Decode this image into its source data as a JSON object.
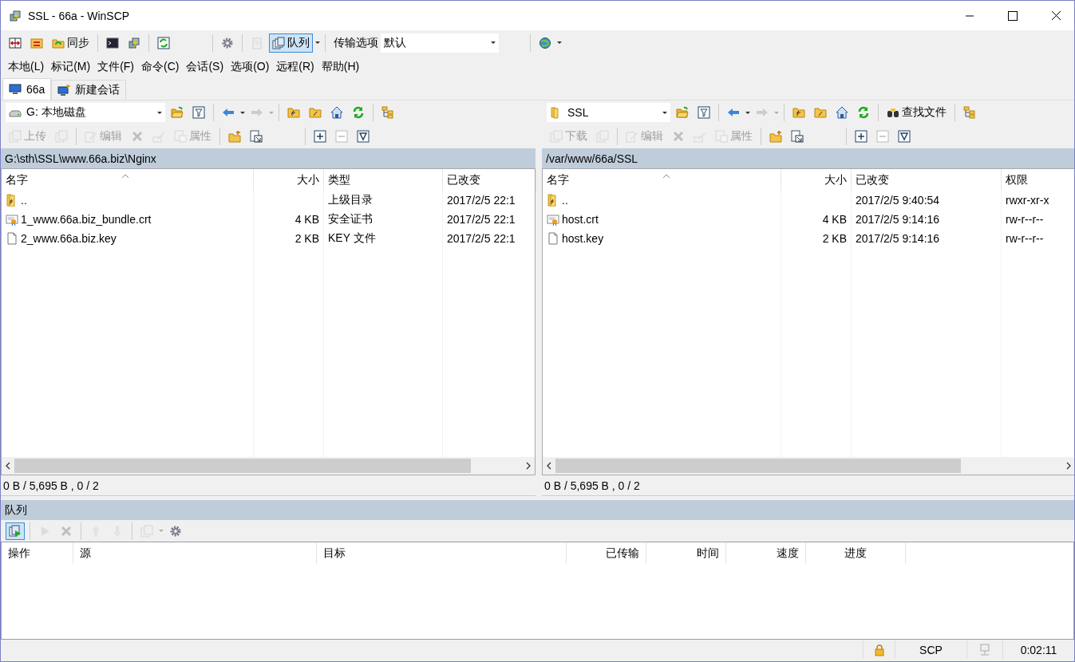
{
  "window": {
    "title": "SSL - 66a - WinSCP"
  },
  "toolbar": {
    "sync_label": "同步",
    "queue": {
      "label": "队列",
      "pressed": true
    },
    "transfer_label": "传输选项",
    "transfer_value": "默认"
  },
  "menu": [
    "本地(L)",
    "标记(M)",
    "文件(F)",
    "命令(C)",
    "会话(S)",
    "选项(O)",
    "远程(R)",
    "帮助(H)"
  ],
  "tabs": [
    {
      "label": "66a",
      "selected": true,
      "kind": "session"
    },
    {
      "label": "新建会话",
      "selected": false,
      "kind": "new"
    }
  ],
  "panels": [
    {
      "location": {
        "label": "G: 本地磁盘",
        "kind": "drive"
      },
      "actions": [
        {
          "label": "上传",
          "kind": "transfer",
          "disabled": true
        },
        {
          "label": "编辑",
          "kind": "edit",
          "disabled": true
        },
        {
          "label": "属性",
          "kind": "properties",
          "disabled": true
        }
      ],
      "path": "G:\\sth\\SSL\\www.66a.biz\\Nginx",
      "columns": [
        {
          "label": "名字",
          "sorted": true
        },
        {
          "label": "大小",
          "sorted": false
        },
        {
          "label": "类型",
          "sorted": false
        },
        {
          "label": "已改变",
          "sorted": false
        }
      ],
      "rows": [
        {
          "kind": "parent",
          "cells": [
            "..",
            "",
            "上级目录",
            "2017/2/5  22:1"
          ]
        },
        {
          "kind": "certificate",
          "cells": [
            "1_www.66a.biz_bundle.crt",
            "4 KB",
            "安全证书",
            "2017/2/5  22:1"
          ]
        },
        {
          "kind": "file",
          "cells": [
            "2_www.66a.biz.key",
            "2 KB",
            "KEY 文件",
            "2017/2/5  22:1"
          ]
        }
      ],
      "status": "0 B / 5,695 B ,  0 / 2"
    },
    {
      "location": {
        "label": "SSL",
        "kind": "folder"
      },
      "find_label": "查找文件",
      "actions": [
        {
          "label": "下载",
          "kind": "transfer",
          "disabled": true
        },
        {
          "label": "编辑",
          "kind": "edit",
          "disabled": true
        },
        {
          "label": "属性",
          "kind": "properties",
          "disabled": true
        }
      ],
      "path": "/var/www/66a/SSL",
      "columns": [
        {
          "label": "名字",
          "sorted": true
        },
        {
          "label": "大小",
          "sorted": false
        },
        {
          "label": "已改变",
          "sorted": false
        },
        {
          "label": "权限",
          "sorted": false
        }
      ],
      "rows": [
        {
          "kind": "parent",
          "cells": [
            "..",
            "",
            "2017/2/5 9:40:54",
            "rwxr-xr-x"
          ]
        },
        {
          "kind": "certificate",
          "cells": [
            "host.crt",
            "4 KB",
            "2017/2/5 9:14:16",
            "rw-r--r--"
          ]
        },
        {
          "kind": "file",
          "cells": [
            "host.key",
            "2 KB",
            "2017/2/5 9:14:16",
            "rw-r--r--"
          ]
        }
      ],
      "status": "0 B / 5,695 B ,  0 / 2"
    }
  ],
  "queue": {
    "title": "队列",
    "columns": [
      "操作",
      "源",
      "目标",
      "已传输",
      "时间",
      "速度",
      "进度"
    ]
  },
  "status_bar": {
    "protocol": "SCP",
    "elapsed": "0:02:11"
  }
}
